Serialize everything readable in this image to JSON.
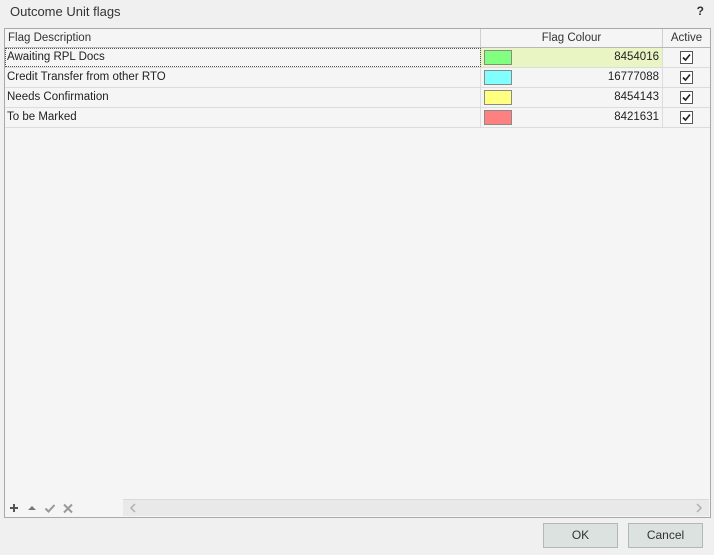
{
  "dialog": {
    "title": "Outcome Unit flags",
    "help_label": "?"
  },
  "grid": {
    "columns": {
      "description": "Flag Description",
      "colour": "Flag Colour",
      "active": "Active"
    },
    "rows": [
      {
        "description": "Awaiting RPL Docs",
        "colour_value": "8454016",
        "swatch_color": "#80ff80",
        "active": true,
        "selected": true
      },
      {
        "description": "Credit Transfer from other RTO",
        "colour_value": "16777088",
        "swatch_color": "#80ffff",
        "active": true,
        "selected": false
      },
      {
        "description": "Needs Confirmation",
        "colour_value": "8454143",
        "swatch_color": "#ffff80",
        "active": true,
        "selected": false
      },
      {
        "description": "To be Marked",
        "colour_value": "8421631",
        "swatch_color": "#ff8080",
        "active": true,
        "selected": false
      }
    ]
  },
  "navigator": {
    "icons": [
      "plus-icon",
      "up-arrow-icon",
      "check-icon",
      "cross-icon"
    ]
  },
  "buttons": {
    "ok": "OK",
    "cancel": "Cancel"
  },
  "colors": {
    "selected_colour_cell": "#eaf5c4",
    "button_face": "#dbe2df"
  }
}
